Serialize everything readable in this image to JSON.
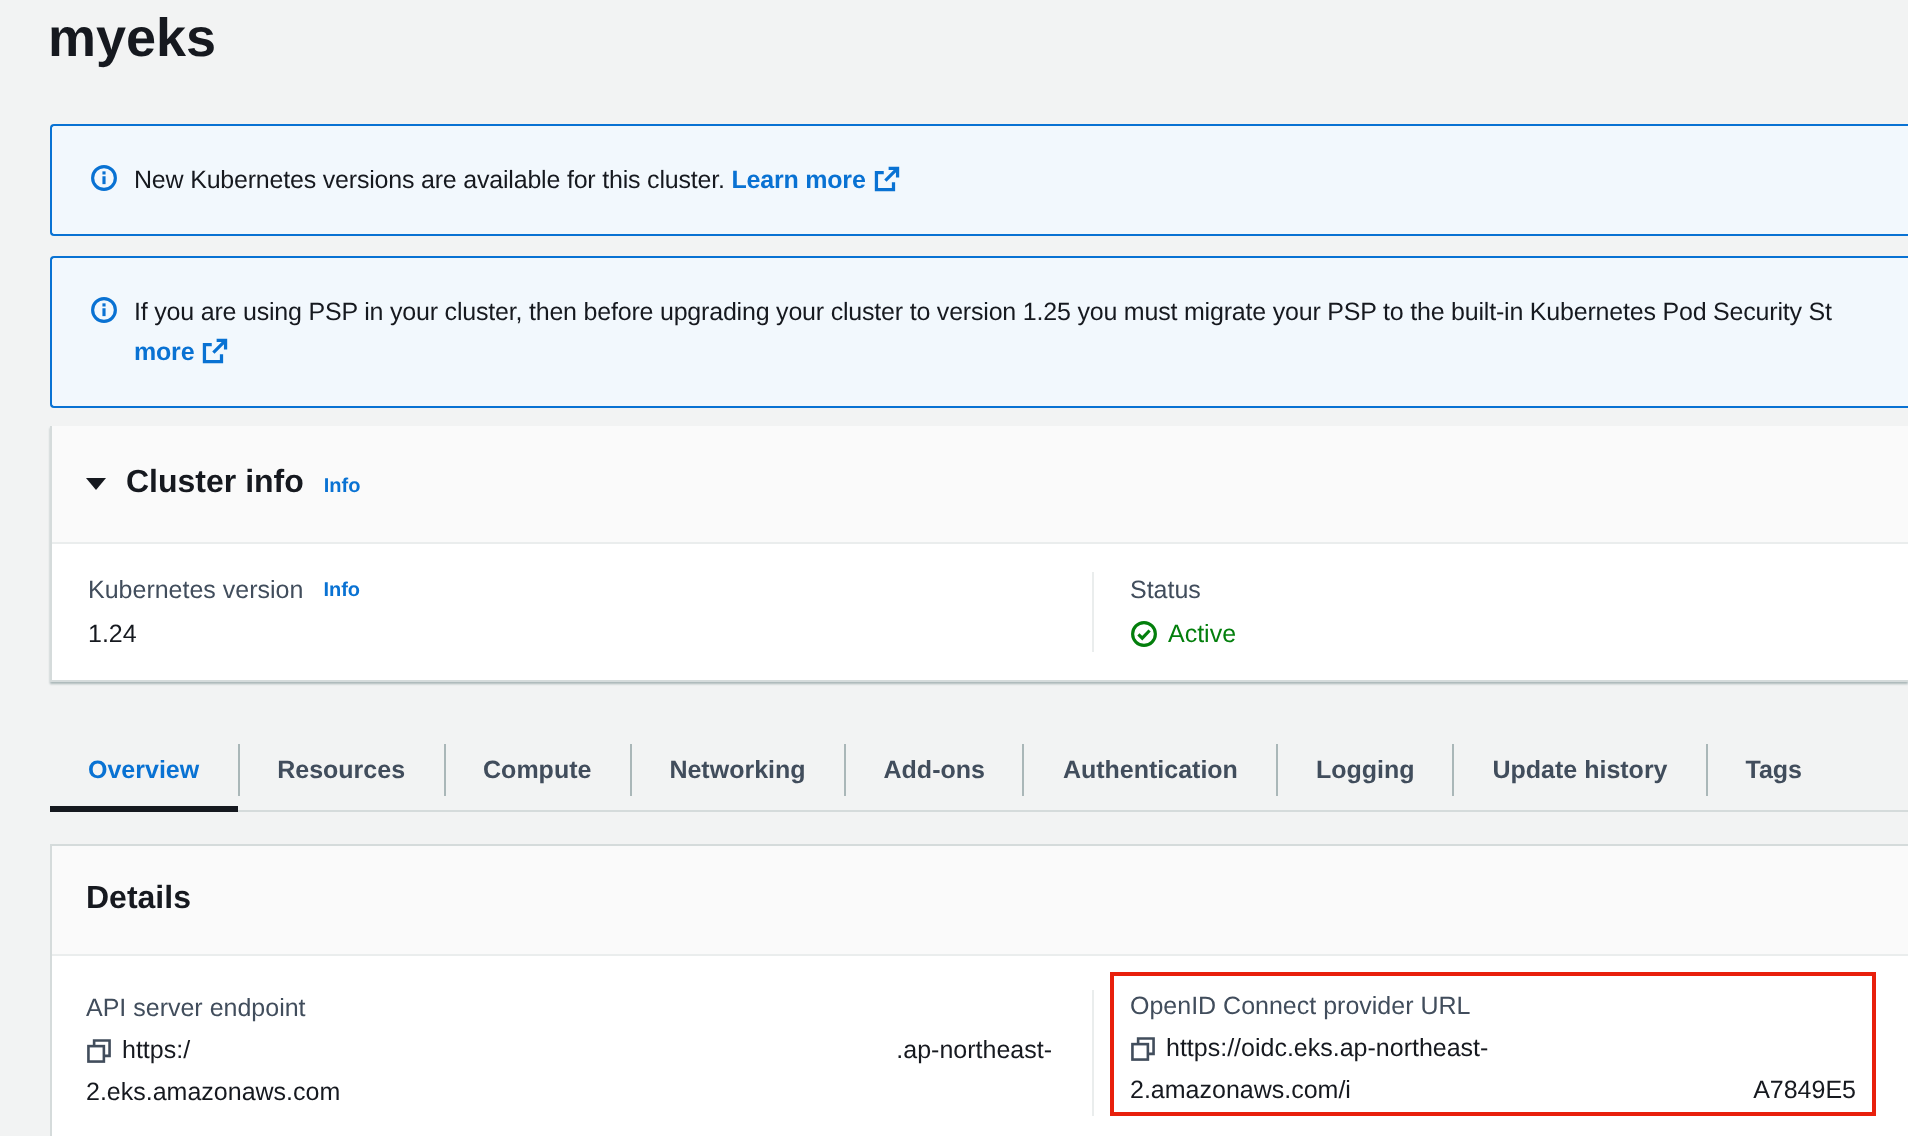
{
  "title": "myeks",
  "alerts": [
    {
      "text": "New Kubernetes versions are available for this cluster.",
      "link": "Learn more"
    },
    {
      "text": "If you are using PSP in your cluster, then before upgrading your cluster to version 1.25 you must migrate your PSP to the built-in Kubernetes Pod Security St",
      "link": "more"
    }
  ],
  "cluster_info": {
    "title": "Cluster info",
    "info": "Info",
    "expanded": true,
    "fields": [
      {
        "label": "Kubernetes version",
        "info": "Info",
        "value": "1.24",
        "kind": "text"
      },
      {
        "label": "Status",
        "value": "Active",
        "kind": "status"
      }
    ]
  },
  "tabs": [
    {
      "label": "Overview",
      "selected": true
    },
    {
      "label": "Resources",
      "selected": false
    },
    {
      "label": "Compute",
      "selected": false
    },
    {
      "label": "Networking",
      "selected": false
    },
    {
      "label": "Add-ons",
      "selected": false
    },
    {
      "label": "Authentication",
      "selected": false
    },
    {
      "label": "Logging",
      "selected": false
    },
    {
      "label": "Update history",
      "selected": false
    },
    {
      "label": "Tags",
      "selected": false
    }
  ],
  "details": {
    "title": "Details",
    "fields": [
      {
        "label": "API server endpoint",
        "parts": [
          "https:/",
          ".ap-northeast-"
        ],
        "line2": [
          "2.eks.amazonaws.com"
        ]
      },
      {
        "label": "OpenID Connect provider URL",
        "parts": [
          "https://oidc.eks.ap-northeast-"
        ],
        "line2": [
          "2.amazonaws.com/i",
          "A7849E5"
        ],
        "highlighted": true
      }
    ]
  }
}
